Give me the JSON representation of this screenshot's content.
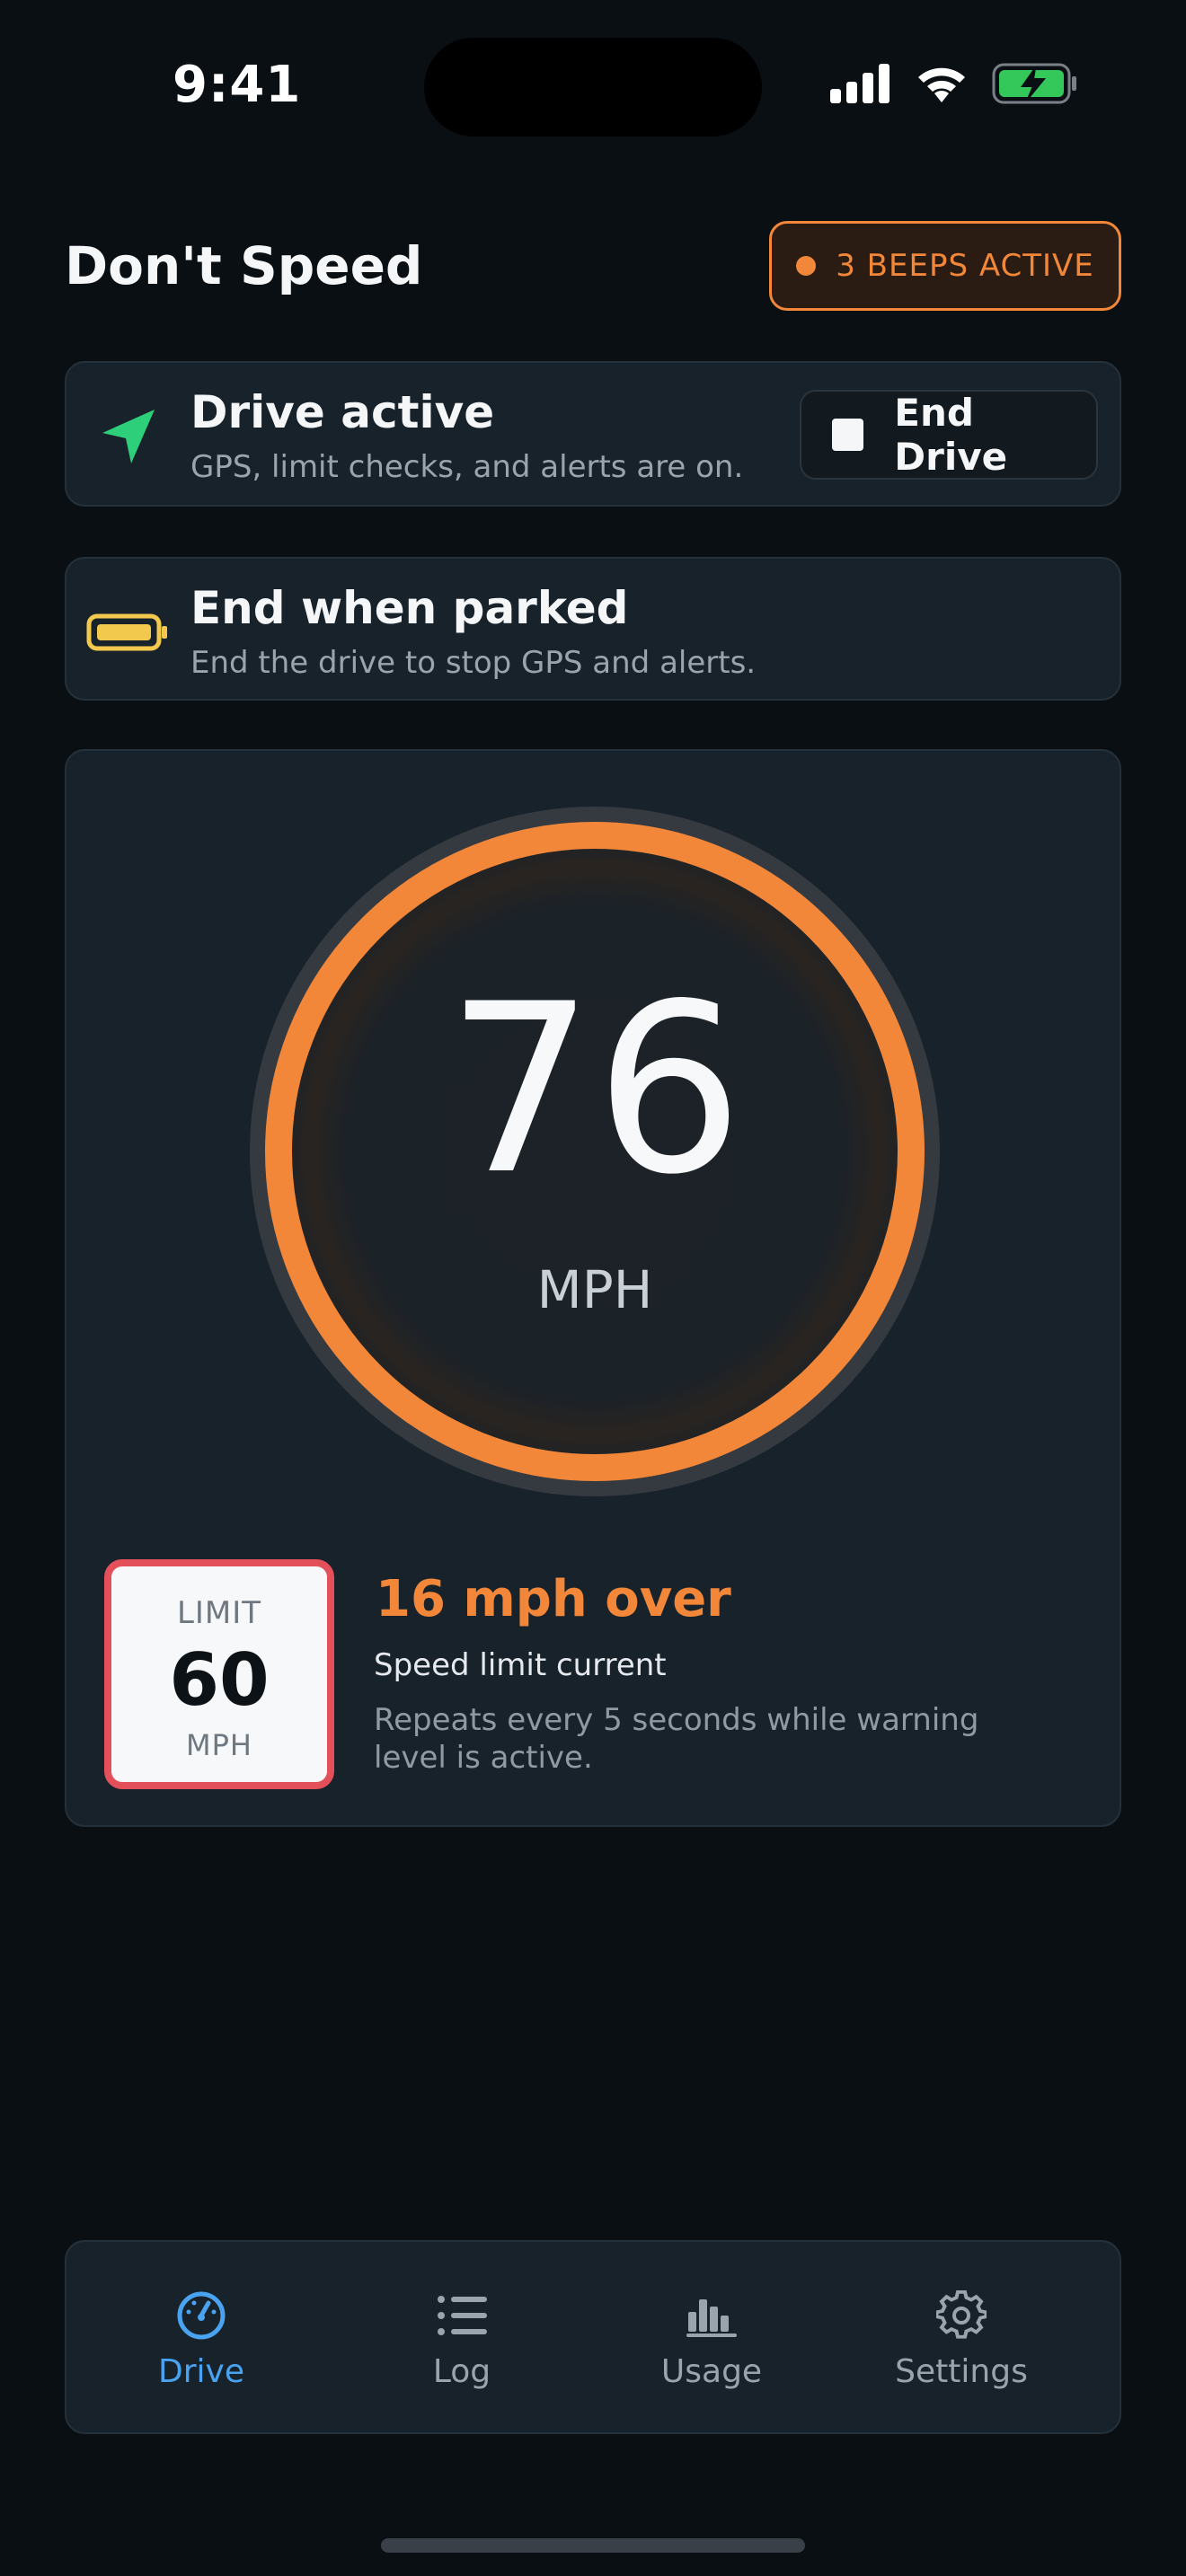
{
  "status_bar": {
    "time": "9:41"
  },
  "header": {
    "title": "Don't Speed",
    "badge": "3 BEEPS ACTIVE"
  },
  "drive_card": {
    "icon": "navigation-arrow-icon",
    "title": "Drive active",
    "subtitle": "GPS, limit checks, and alerts are on.",
    "button_label": "End Drive"
  },
  "parked_card": {
    "icon": "battery-icon",
    "title": "End when parked",
    "subtitle": "End the drive to stop GPS and alerts."
  },
  "speed": {
    "value": "76",
    "unit": "MPH"
  },
  "limit": {
    "label": "LIMIT",
    "value": "60",
    "unit": "MPH"
  },
  "warning": {
    "over": "16 mph over",
    "status": "Speed limit current",
    "description": "Repeats every 5 seconds while warning level is active."
  },
  "tabs": [
    {
      "label": "Drive",
      "icon": "speedometer-icon",
      "active": true
    },
    {
      "label": "Log",
      "icon": "list-icon",
      "active": false
    },
    {
      "label": "Usage",
      "icon": "bar-chart-icon",
      "active": false
    },
    {
      "label": "Settings",
      "icon": "gear-icon",
      "active": false
    }
  ],
  "colors": {
    "accent_orange": "#f2873a",
    "limit_red": "#e4505a",
    "active_tab_blue": "#4aa3f0",
    "go_green": "#2ecf7a",
    "battery_yellow": "#f2c94c"
  }
}
